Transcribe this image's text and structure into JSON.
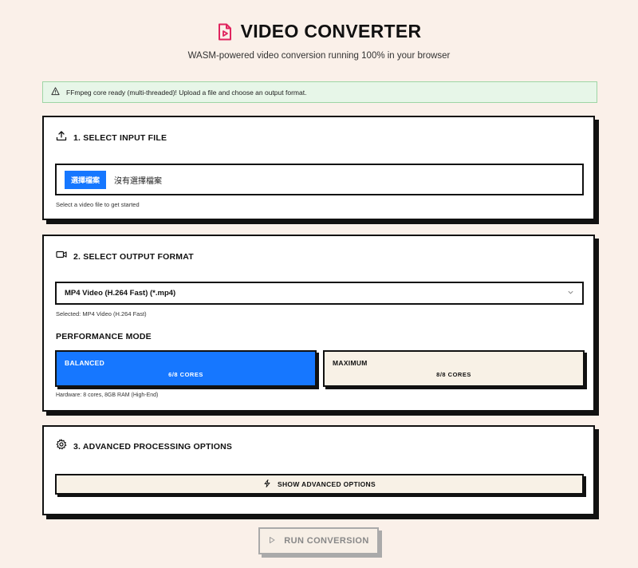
{
  "header": {
    "title": "VIDEO CONVERTER",
    "subtitle": "WASM-powered video conversion running 100% in your browser",
    "icon": "file-video-icon"
  },
  "status_banner": {
    "text": "FFmpeg core ready (multi-threaded)! Upload a file and choose an output format.",
    "icon": "warning-triangle-icon"
  },
  "input_section": {
    "title": "1. SELECT INPUT FILE",
    "icon": "upload-icon",
    "choose_button": "選擇檔案",
    "no_file_text": "沒有選擇檔案",
    "helper": "Select a video file to get started"
  },
  "output_section": {
    "title": "2. SELECT OUTPUT FORMAT",
    "icon": "video-camera-icon",
    "selected_format": "MP4 Video (H.264 Fast) (*.mp4)",
    "selected_caption": "Selected: MP4 Video (H.264 Fast)",
    "performance_label": "PERFORMANCE MODE",
    "modes": [
      {
        "name": "BALANCED",
        "cores": "6/8 CORES",
        "active": true
      },
      {
        "name": "MAXIMUM",
        "cores": "8/8 CORES",
        "active": false
      }
    ],
    "hardware": "Hardware: 8 cores, 8GB RAM (High-End)"
  },
  "advanced_section": {
    "title": "3. ADVANCED PROCESSING OPTIONS",
    "icon": "gear-icon",
    "toggle_button": "SHOW ADVANCED OPTIONS"
  },
  "run_button": {
    "label": "RUN CONVERSION",
    "disabled": true
  },
  "colors": {
    "accent": "#1677ff",
    "brand_icon": "#e0245e",
    "background": "#faf0e9",
    "banner_bg": "#e7f6e8",
    "banner_border": "#9ed5a5"
  }
}
